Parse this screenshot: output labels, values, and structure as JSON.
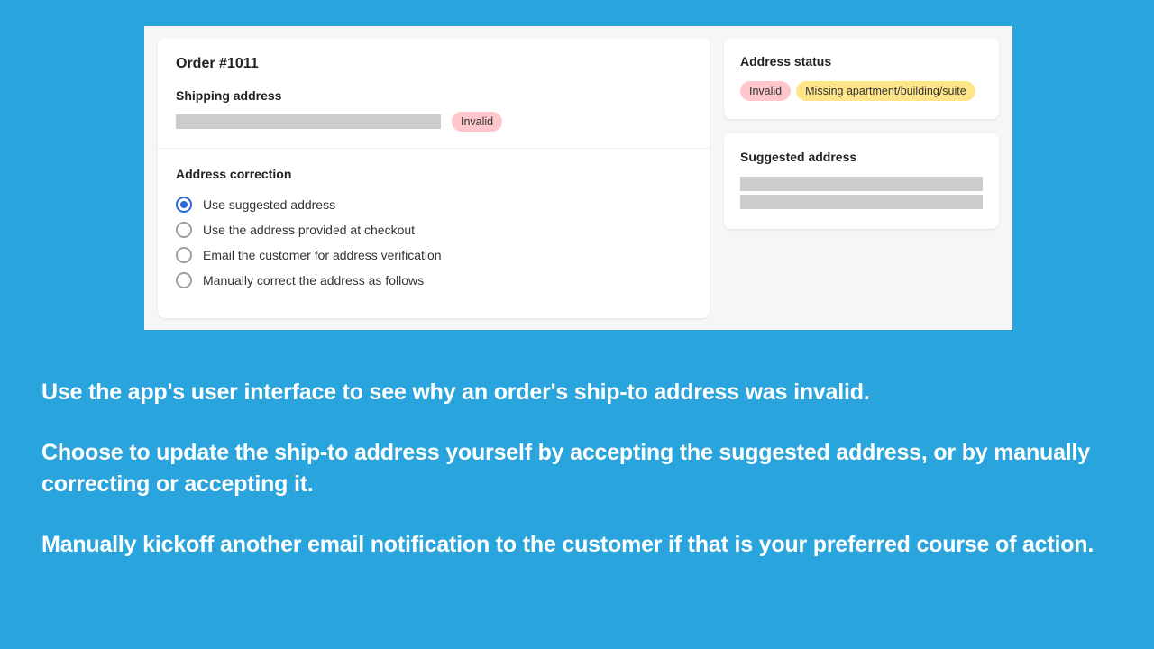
{
  "order": {
    "title": "Order #1011",
    "shipping_label": "Shipping address",
    "invalid_badge": "Invalid"
  },
  "correction": {
    "heading": "Address correction",
    "options": [
      {
        "label": "Use suggested address",
        "selected": true
      },
      {
        "label": "Use the address provided at checkout",
        "selected": false
      },
      {
        "label": "Email the customer for address verification",
        "selected": false
      },
      {
        "label": "Manually correct the address as follows",
        "selected": false
      }
    ]
  },
  "status": {
    "heading": "Address status",
    "badges": [
      {
        "text": "Invalid",
        "color": "pink"
      },
      {
        "text": "Missing apartment/building/suite",
        "color": "yellow"
      }
    ]
  },
  "suggested": {
    "heading": "Suggested address"
  },
  "promo": {
    "p1": "Use the app's user interface to see why an order's ship-to address was invalid.",
    "p2": "Choose to update the ship-to address yourself by accepting the suggested address, or by manually correcting or accepting it.",
    "p3": "Manually kickoff another email notification to the customer if that is your preferred course of action."
  }
}
